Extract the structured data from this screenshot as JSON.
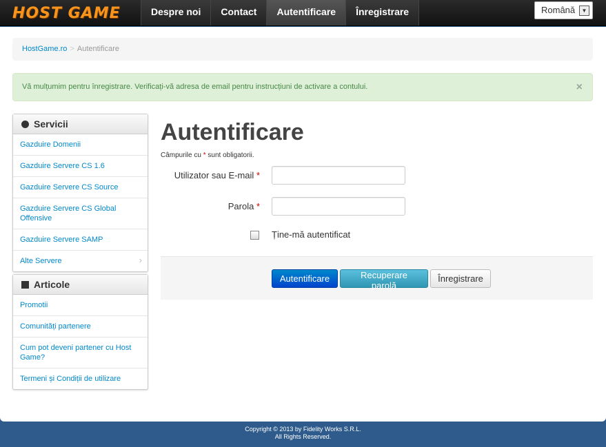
{
  "brand": {
    "logo_text": "HOST GAME"
  },
  "nav": {
    "items": [
      {
        "label": "Despre noi"
      },
      {
        "label": "Contact"
      },
      {
        "label": "Autentificare"
      },
      {
        "label": "Înregistrare"
      }
    ]
  },
  "language": {
    "selected": "Română"
  },
  "breadcrumb": {
    "home": "HostGame.ro",
    "sep": ">",
    "current": "Autentificare"
  },
  "alert": {
    "message": "Vă mulțumim pentru înregistrare. Verificați-vă adresa de email pentru instrucțiuni de activare a contului.",
    "close": "×"
  },
  "sidebar": {
    "services": {
      "title": "Servicii",
      "items": [
        "Gazduire Domenii",
        "Gazduire Servere CS 1.6",
        "Gazduire Servere CS Source",
        "Gazduire Servere CS Global Offensive",
        "Gazduire Servere SAMP",
        "Alte Servere"
      ]
    },
    "articles": {
      "title": "Articole",
      "items": [
        "Promotii",
        "Comunități partenere",
        "Cum pot deveni partener cu Host Game?",
        "Termeni și Condiții de utilizare"
      ]
    }
  },
  "form": {
    "title": "Autentificare",
    "required_prefix": "Câmpurile cu",
    "required_star": "*",
    "required_suffix": "sunt obligatorii.",
    "username_label": "Utilizator sau E-mail",
    "password_label": "Parola",
    "remember_label": "Ține-mă autentificat",
    "username_value": "",
    "password_value": "",
    "login_button": "Autentificare",
    "recover_button": "Recuperare parolă",
    "register_button": "Înregistrare"
  },
  "footer": {
    "line1": "Copyright © 2013 by Fidelity Works S.R.L.",
    "line2": "All Rights Reserved."
  }
}
